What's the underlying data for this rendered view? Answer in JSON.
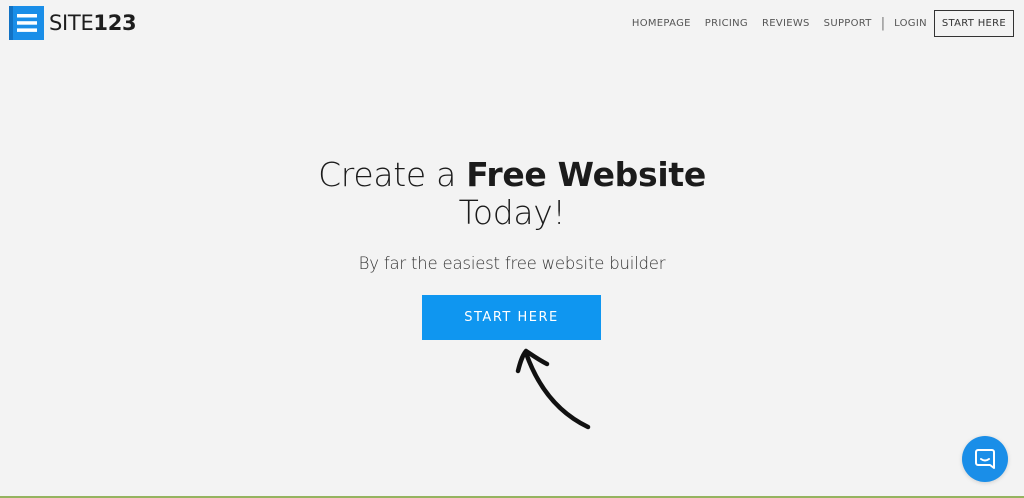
{
  "logo": {
    "text_light": "SITE",
    "text_bold": "123",
    "icon": "menu-lines-icon",
    "color": "#1a8ee8"
  },
  "nav": {
    "items": [
      "HOMEPAGE",
      "PRICING",
      "REVIEWS",
      "SUPPORT"
    ],
    "separator": "|",
    "login": "LOGIN",
    "cta": "START HERE"
  },
  "hero": {
    "title_part1": "Create a ",
    "title_strong": "Free Website",
    "title_line2": "Today!",
    "subtitle": "By far the easiest free website builder",
    "cta": "START HERE",
    "cta_color": "#0f96f0"
  },
  "annotation": {
    "icon": "curved-arrow-icon"
  },
  "chat": {
    "icon": "chat-bubble-icon",
    "color": "#1a8ee8"
  }
}
